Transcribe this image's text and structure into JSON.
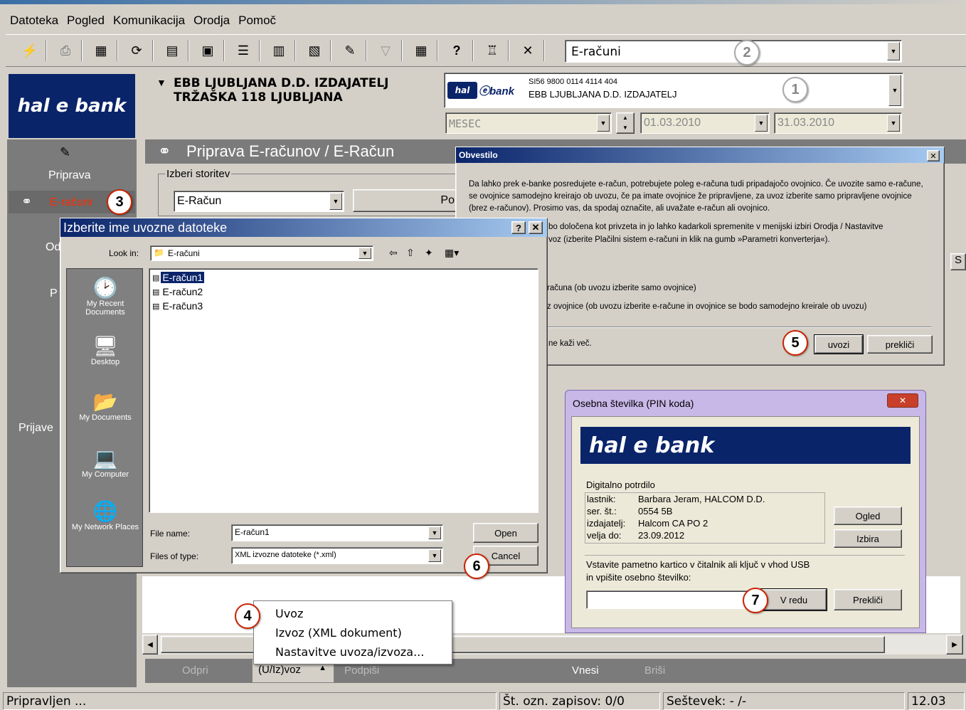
{
  "menu": [
    "Datoteka",
    "Pogled",
    "Komunikacija",
    "Orodja",
    "Pomoč"
  ],
  "toolbar": {
    "combo_value": "E-računi"
  },
  "account": {
    "holder_line1": "EBB LJUBLJANA D.D. IZDAJATELJ",
    "holder_line2": "TRŽAŠKA 118 LJUBLJANA",
    "iban": "SI56 9800 0114 4114 404",
    "name": "EBB LJUBLJANA D.D. IZDAJATELJ",
    "period": "MESEC",
    "date_from": "01.03.2010",
    "date_to": "31.03.2010"
  },
  "logo_text": "hal e bank",
  "sidebar": {
    "items": [
      "Priprava",
      "E-računi",
      "Od",
      "P",
      "Prijave"
    ]
  },
  "main": {
    "header": "Priprava E-računov / E-Račun",
    "service_group": "Izberi storitev",
    "service_value": "E-Račun",
    "po_button": "Po",
    "col_s": "S"
  },
  "bottom_bar": {
    "odpri": "Odpri",
    "uiz": "(U/Iz)voz",
    "podpisi": "Podpiši",
    "vnesi": "Vnesi",
    "brisi": "Briši"
  },
  "popup_menu": [
    "Uvoz",
    "Izvoz (XML dokument)",
    "Nastavitve uvoza/izvoza..."
  ],
  "status": {
    "left": "Pripravljen ...",
    "records": "Št. ozn. zapisov: 0/0",
    "sum": "Seštevek: - /-",
    "time": "12.03"
  },
  "notice": {
    "title": "Obvestilo",
    "p1": "Da lahko prek e-banke posredujete e-račun, potrebujete poleg e-računa tudi pripadajočo ovojnico. Če uvozite samo e-račune, se ovojnice samodejno kreirajo ob uvozu, če pa imate ovojnice že pripravljene, za uvoz izberite samo pripravljene ovojnice (brez e-računov). Prosimo vas, da spodaj označite, ali uvažate e-račun ali ovojnico.",
    "p2a": "bo določena kot privzeta in jo lahko kadarkoli spremenite v menijski izbiri Orodja / Nastavitve",
    "p2b": "voz (izberite Plačilni sistem e-računi in klik na gumb »Parametri konverterja«).",
    "opt1": "računa (ob uvozu izberite samo ovojnice)",
    "opt2": "z ovojnice (ob uvozu izberite e-račune in ovojnice se bodo samodejno kreirale ob uvozu)",
    "dont_show": "ne kaži več.",
    "import_btn": "uvozi",
    "cancel_btn": "prekliči"
  },
  "file_dialog": {
    "title": "Izberite ime uvozne datoteke",
    "look_in_label": "Look in:",
    "look_in_value": "E-računi",
    "places": [
      "My Recent Documents",
      "Desktop",
      "My Documents",
      "My Computer",
      "My Network Places"
    ],
    "files": [
      "E-račun1",
      "E-račun2",
      "E-račun3"
    ],
    "file_name_label": "File name:",
    "file_name_value": "E-račun1",
    "file_type_label": "Files of type:",
    "file_type_value": "XML izvozne datoteke (*.xml)",
    "open_btn": "Open",
    "cancel_btn": "Cancel"
  },
  "pin_dialog": {
    "title": "Osebna številka (PIN koda)",
    "group": "Digitalno potrdilo",
    "rows": [
      {
        "k": "lastnik:",
        "v": "Barbara Jeram, HALCOM D.D."
      },
      {
        "k": "ser. št.:",
        "v": "0554 5B"
      },
      {
        "k": "izdajatelj:",
        "v": "Halcom CA PO 2"
      },
      {
        "k": "velja do:",
        "v": "23.09.2012"
      }
    ],
    "ogled": "Ogled",
    "izbira": "Izbira",
    "instr1": "Vstavite pametno kartico v čitalnik ali ključ v vhod USB",
    "instr2": "in vpišite osebno številko:",
    "ok": "V redu",
    "cancel": "Prekliči"
  },
  "callouts": [
    "1",
    "2",
    "3",
    "4",
    "5",
    "6",
    "7"
  ],
  "colors": {
    "navy": "#0a246a",
    "sidebar": "#7b7b7b",
    "accent_red": "#ff2a00"
  }
}
